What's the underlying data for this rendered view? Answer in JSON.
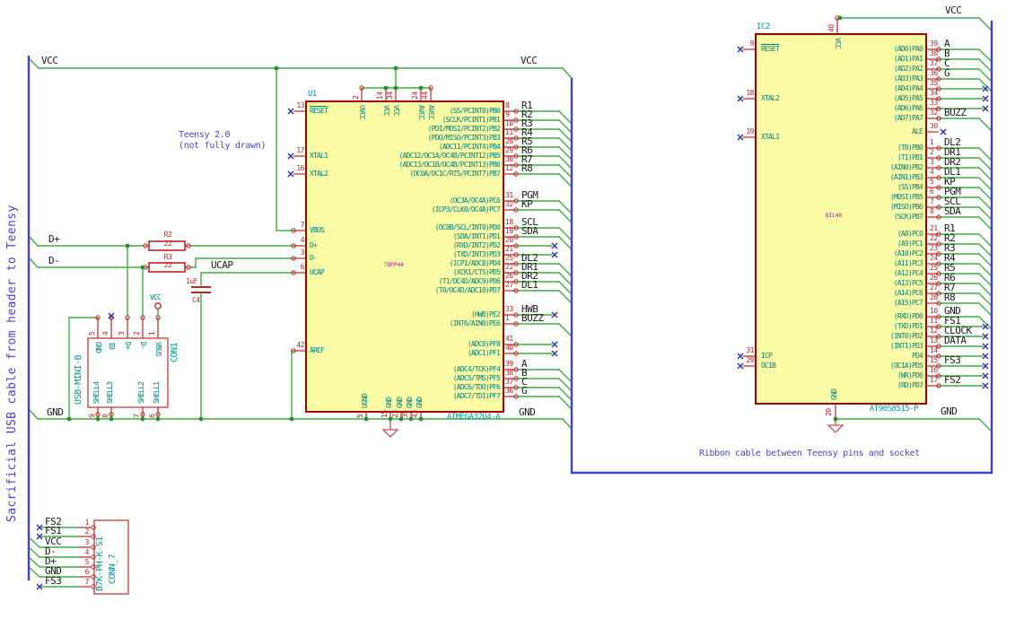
{
  "notes": {
    "usb_cable": "Sacrificial USB cable from header to Teensy",
    "teensy_line1": "Teensy 2.0",
    "teensy_line2": "(not fully drawn)",
    "ribbon": "Ribbon cable between Teensy pins and socket"
  },
  "labels": {
    "vcc_left": "VCC",
    "vcc_right": "VCC",
    "gnd_left": "GND",
    "gnd_right": "GND",
    "dplus": "D+",
    "dminus": "D-",
    "ucap": "UCAP",
    "ic2_vcc": "VCC",
    "ic2_gnd": "GND",
    "con1_vcc": "VCC"
  },
  "colors": {
    "wire": "#3fae3f",
    "pin": "#c22222",
    "body_fill": "#fbfba5",
    "body_line": "#a40000",
    "blue_line": "#4141cc",
    "noconnect": "#2d2db4",
    "pin_name": "#008484",
    "footprint": "#b400b4",
    "label": "#1a1a1a"
  },
  "u1": {
    "ref": "U1",
    "value": "ATMEGA32U4-A",
    "footprint": "TQFP44",
    "top_pins": [
      {
        "num": "2",
        "name": "UVCC"
      },
      {
        "num": "14",
        "name": "VCC"
      },
      {
        "num": "34",
        "name": "VCC"
      },
      {
        "num": "24",
        "name": "AVCC"
      },
      {
        "num": "44",
        "name": "AVCC"
      }
    ],
    "left_pins": [
      {
        "num": "13",
        "name": "RESET",
        "end": "x"
      },
      {
        "num": "17",
        "name": "XTAL1",
        "end": "x"
      },
      {
        "num": "16",
        "name": "XTAL2",
        "end": "x"
      },
      {
        "num": "7",
        "name": "VBUS",
        "end": "wire"
      },
      {
        "num": "4",
        "name": "D+",
        "end": "wire"
      },
      {
        "num": "3",
        "name": "D-",
        "end": "wire"
      },
      {
        "num": "6",
        "name": "UCAP",
        "end": "wire"
      },
      {
        "num": "42",
        "name": "AREF",
        "end": "wire"
      }
    ],
    "right_pins": [
      {
        "num": "8",
        "name": "(SS/PCINT0)PB0",
        "net": "R1",
        "end": "diag"
      },
      {
        "num": "9",
        "name": "(SCLK/PCINT1)PB1",
        "net": "R2",
        "end": "diag"
      },
      {
        "num": "10",
        "name": "(PDI/MOSI/PCINT2)PB2",
        "net": "R3",
        "end": "diag"
      },
      {
        "num": "11",
        "name": "(PDO/MISO/PCINT3)PB3",
        "net": "R4",
        "end": "diag"
      },
      {
        "num": "28",
        "name": "(ADC11/PCINT4)PB4",
        "net": "R5",
        "end": "diag"
      },
      {
        "num": "29",
        "name": "(ADC12/OC1A/OC4B/PCINT12)PB5",
        "net": "R6",
        "end": "diag"
      },
      {
        "num": "30",
        "name": "(ADC13/OC1B/OC4B/PCINT13)PB6",
        "net": "R7",
        "end": "diag"
      },
      {
        "num": "12",
        "name": "(OC0A/OC1C/RTS/PCINT7)PB7",
        "net": "R8",
        "end": "diag"
      },
      {
        "num": "31",
        "name": "(OC3A/OC4A)PC6",
        "net": "PGM",
        "end": "diag"
      },
      {
        "num": "32",
        "name": "(ICP3/CLK0/OC4A)PC7",
        "net": "KP",
        "end": "diag"
      },
      {
        "num": "18",
        "name": "(OC0B/SCL/INT0)PD0",
        "net": "SCL",
        "end": "diag"
      },
      {
        "num": "19",
        "name": "(SDA/INT1)PD1",
        "net": "SDA",
        "end": "diag"
      },
      {
        "num": "20",
        "name": "(RXD/INT2)PD2",
        "net": "",
        "end": "x"
      },
      {
        "num": "21",
        "name": "(TXD/INT3)PD3",
        "net": "",
        "end": "x"
      },
      {
        "num": "25",
        "name": "(ICP1/ADC8)PD4",
        "net": "DL2",
        "end": "diag"
      },
      {
        "num": "22",
        "name": "(XCK1/CTS)PD5",
        "net": "DR1",
        "end": "diag"
      },
      {
        "num": "26",
        "name": "(T1/OC4D/ADC9)PD6",
        "net": "DR2",
        "end": "diag"
      },
      {
        "num": "27",
        "name": "(T0/OC4D/ADC10)PD7",
        "net": "DL1",
        "end": "diag"
      },
      {
        "num": "33",
        "name": "(HWB)PE2",
        "net": "HWB",
        "end": "labelx"
      },
      {
        "num": "1",
        "name": "(INT6/AIN0)PE6",
        "net": "BUZZ",
        "end": "diag"
      },
      {
        "num": "41",
        "name": "(ADC0)PF0",
        "net": "",
        "end": "x"
      },
      {
        "num": "40",
        "name": "(ADC1)PF1",
        "net": "",
        "end": "x"
      },
      {
        "num": "39",
        "name": "(ADC4/TCK)PF4",
        "net": "A",
        "end": "diag"
      },
      {
        "num": "38",
        "name": "(ADC5/TMS)PF5",
        "net": "B",
        "end": "diag"
      },
      {
        "num": "37",
        "name": "(ADC6/TDO)PF6",
        "net": "C",
        "end": "diag"
      },
      {
        "num": "36",
        "name": "(ADC7/TDI)PF7",
        "net": "G",
        "end": "diag"
      }
    ],
    "bottom_pins": [
      {
        "num": "5",
        "name": "UGND"
      },
      {
        "num": "15",
        "name": "GND"
      },
      {
        "num": "23",
        "name": "GND"
      },
      {
        "num": "35",
        "name": "GND"
      },
      {
        "num": "43",
        "name": "GND"
      }
    ]
  },
  "ic2": {
    "ref": "IC2",
    "value": "AT90S8515-P",
    "footprint": "DIL40",
    "top_pin": {
      "num": "40",
      "name": "VCC"
    },
    "bottom_pin": {
      "num": "20",
      "name": "GND"
    },
    "left_pins": [
      {
        "num": "9",
        "name": "RESET"
      },
      {
        "num": "18",
        "name": "XTAL2"
      },
      {
        "num": "19",
        "name": "XTAL1"
      },
      {
        "num": "31",
        "name": "ICP"
      },
      {
        "num": "29",
        "name": "OC1B"
      }
    ],
    "right_pins": [
      {
        "num": "39",
        "name": "(AD0)PA0",
        "net": "A",
        "end": "diag"
      },
      {
        "num": "38",
        "name": "(AD1)PA1",
        "net": "B",
        "end": "diag"
      },
      {
        "num": "37",
        "name": "(AD2)PA2",
        "net": "C",
        "end": "diag"
      },
      {
        "num": "36",
        "name": "(AD3)PA3",
        "net": "G",
        "end": "diag"
      },
      {
        "num": "35",
        "name": "(AD4)PA4",
        "net": "",
        "end": "x"
      },
      {
        "num": "34",
        "name": "(AD5)PA5",
        "net": "",
        "end": "x"
      },
      {
        "num": "33",
        "name": "(AD6)PA6",
        "net": "",
        "end": "x"
      },
      {
        "num": "32",
        "name": "(AD7)PA7",
        "net": "BUZZ",
        "end": "diag"
      },
      {
        "num": "30",
        "name": "ALE",
        "net": "",
        "end": "xnear"
      },
      {
        "num": "1",
        "name": "(T0)PB0",
        "net": "DL2",
        "end": "diag"
      },
      {
        "num": "2",
        "name": "(T1)PB1",
        "net": "DR1",
        "end": "diag"
      },
      {
        "num": "3",
        "name": "(AIN0)PB2",
        "net": "DR2",
        "end": "diag"
      },
      {
        "num": "4",
        "name": "(AIN1)PB3",
        "net": "DL1",
        "end": "diag"
      },
      {
        "num": "5",
        "name": "(SS)PB4",
        "net": "KP",
        "end": "diag"
      },
      {
        "num": "6",
        "name": "(MOSI)PB5",
        "net": "PGM",
        "end": "diag"
      },
      {
        "num": "7",
        "name": "(MISO)PB6",
        "net": "SCL",
        "end": "diag"
      },
      {
        "num": "8",
        "name": "(SCK)PB7",
        "net": "SDA",
        "end": "diag"
      },
      {
        "num": "21",
        "name": "(A8)PC0",
        "net": "R1",
        "end": "diag"
      },
      {
        "num": "22",
        "name": "(A9)PC1",
        "net": "R2",
        "end": "diag"
      },
      {
        "num": "23",
        "name": "(A10)PC2",
        "net": "R3",
        "end": "diag"
      },
      {
        "num": "24",
        "name": "(A11)PC3",
        "net": "R4",
        "end": "diag"
      },
      {
        "num": "25",
        "name": "(A12)PC4",
        "net": "R5",
        "end": "diag"
      },
      {
        "num": "26",
        "name": "(A13)PC5",
        "net": "R6",
        "end": "diag"
      },
      {
        "num": "27",
        "name": "(A14)PC6",
        "net": "R7",
        "end": "diag"
      },
      {
        "num": "28",
        "name": "(A15)PC7",
        "net": "R8",
        "end": "diag"
      },
      {
        "num": "10",
        "name": "(RXD)PD0",
        "net": "GND",
        "end": "diag"
      },
      {
        "num": "11",
        "name": "(TXD)PD1",
        "net": "FS1",
        "end": "labelx"
      },
      {
        "num": "12",
        "name": "(INT0)PD2",
        "net": "CLOCK",
        "end": "labelx"
      },
      {
        "num": "13",
        "name": "(INT1)PD3",
        "net": "DATA",
        "end": "labelx"
      },
      {
        "num": "14",
        "name": "PD4",
        "net": "",
        "end": "x"
      },
      {
        "num": "15",
        "name": "(OC1A)PD5",
        "net": "FS3",
        "end": "labelx"
      },
      {
        "num": "16",
        "name": "(WR)PD6",
        "net": "",
        "end": "x"
      },
      {
        "num": "17",
        "name": "(RD)PD7",
        "net": "FS2",
        "end": "labelx"
      }
    ]
  },
  "con1": {
    "ref": "CON1",
    "value": "USB-MINI-B",
    "top_pins": [
      {
        "num": "5",
        "name": "GND"
      },
      {
        "num": "4",
        "name": "ID"
      },
      {
        "num": "3",
        "name": "D+"
      },
      {
        "num": "2",
        "name": "D-"
      },
      {
        "num": "1",
        "name": "VBUS"
      }
    ],
    "bottom_pins": [
      {
        "num": "9",
        "name": "SHELL4"
      },
      {
        "num": "8",
        "name": "SHELL3"
      },
      {
        "num": "7",
        "name": "SHELL2"
      },
      {
        "num": "6",
        "name": "SHELL1"
      }
    ]
  },
  "conn7": {
    "ref": "CONN_7",
    "value": "B7K-PH-K-S1",
    "pins": [
      {
        "num": "1",
        "net": "FS2",
        "end": "x"
      },
      {
        "num": "2",
        "net": "FS1",
        "end": "x"
      },
      {
        "num": "3",
        "net": "VCC",
        "end": "diag"
      },
      {
        "num": "4",
        "net": "D-",
        "end": "diag"
      },
      {
        "num": "5",
        "net": "D+",
        "end": "diag"
      },
      {
        "num": "6",
        "net": "GND",
        "end": "diag"
      },
      {
        "num": "7",
        "net": "FS3",
        "end": "x"
      }
    ]
  },
  "r2": {
    "ref": "R2",
    "value": "22"
  },
  "r3": {
    "ref": "R3",
    "value": "22"
  },
  "c4": {
    "ref": "C4",
    "value": "1uF"
  }
}
